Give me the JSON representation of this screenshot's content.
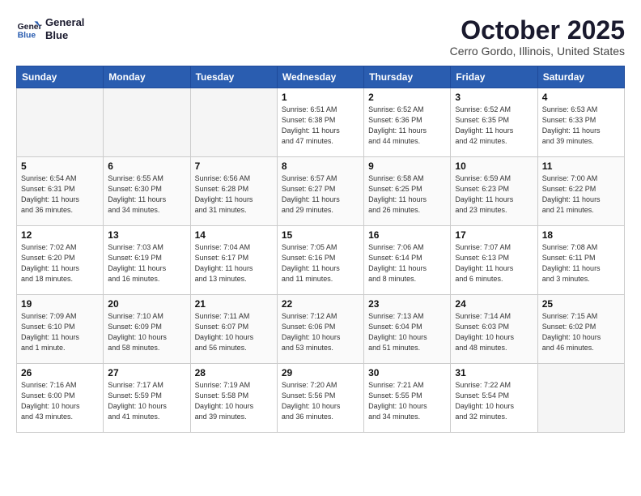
{
  "header": {
    "logo_line1": "General",
    "logo_line2": "Blue",
    "month": "October 2025",
    "location": "Cerro Gordo, Illinois, United States"
  },
  "days_of_week": [
    "Sunday",
    "Monday",
    "Tuesday",
    "Wednesday",
    "Thursday",
    "Friday",
    "Saturday"
  ],
  "weeks": [
    [
      {
        "num": "",
        "info": ""
      },
      {
        "num": "",
        "info": ""
      },
      {
        "num": "",
        "info": ""
      },
      {
        "num": "1",
        "info": "Sunrise: 6:51 AM\nSunset: 6:38 PM\nDaylight: 11 hours\nand 47 minutes."
      },
      {
        "num": "2",
        "info": "Sunrise: 6:52 AM\nSunset: 6:36 PM\nDaylight: 11 hours\nand 44 minutes."
      },
      {
        "num": "3",
        "info": "Sunrise: 6:52 AM\nSunset: 6:35 PM\nDaylight: 11 hours\nand 42 minutes."
      },
      {
        "num": "4",
        "info": "Sunrise: 6:53 AM\nSunset: 6:33 PM\nDaylight: 11 hours\nand 39 minutes."
      }
    ],
    [
      {
        "num": "5",
        "info": "Sunrise: 6:54 AM\nSunset: 6:31 PM\nDaylight: 11 hours\nand 36 minutes."
      },
      {
        "num": "6",
        "info": "Sunrise: 6:55 AM\nSunset: 6:30 PM\nDaylight: 11 hours\nand 34 minutes."
      },
      {
        "num": "7",
        "info": "Sunrise: 6:56 AM\nSunset: 6:28 PM\nDaylight: 11 hours\nand 31 minutes."
      },
      {
        "num": "8",
        "info": "Sunrise: 6:57 AM\nSunset: 6:27 PM\nDaylight: 11 hours\nand 29 minutes."
      },
      {
        "num": "9",
        "info": "Sunrise: 6:58 AM\nSunset: 6:25 PM\nDaylight: 11 hours\nand 26 minutes."
      },
      {
        "num": "10",
        "info": "Sunrise: 6:59 AM\nSunset: 6:23 PM\nDaylight: 11 hours\nand 23 minutes."
      },
      {
        "num": "11",
        "info": "Sunrise: 7:00 AM\nSunset: 6:22 PM\nDaylight: 11 hours\nand 21 minutes."
      }
    ],
    [
      {
        "num": "12",
        "info": "Sunrise: 7:02 AM\nSunset: 6:20 PM\nDaylight: 11 hours\nand 18 minutes."
      },
      {
        "num": "13",
        "info": "Sunrise: 7:03 AM\nSunset: 6:19 PM\nDaylight: 11 hours\nand 16 minutes."
      },
      {
        "num": "14",
        "info": "Sunrise: 7:04 AM\nSunset: 6:17 PM\nDaylight: 11 hours\nand 13 minutes."
      },
      {
        "num": "15",
        "info": "Sunrise: 7:05 AM\nSunset: 6:16 PM\nDaylight: 11 hours\nand 11 minutes."
      },
      {
        "num": "16",
        "info": "Sunrise: 7:06 AM\nSunset: 6:14 PM\nDaylight: 11 hours\nand 8 minutes."
      },
      {
        "num": "17",
        "info": "Sunrise: 7:07 AM\nSunset: 6:13 PM\nDaylight: 11 hours\nand 6 minutes."
      },
      {
        "num": "18",
        "info": "Sunrise: 7:08 AM\nSunset: 6:11 PM\nDaylight: 11 hours\nand 3 minutes."
      }
    ],
    [
      {
        "num": "19",
        "info": "Sunrise: 7:09 AM\nSunset: 6:10 PM\nDaylight: 11 hours\nand 1 minute."
      },
      {
        "num": "20",
        "info": "Sunrise: 7:10 AM\nSunset: 6:09 PM\nDaylight: 10 hours\nand 58 minutes."
      },
      {
        "num": "21",
        "info": "Sunrise: 7:11 AM\nSunset: 6:07 PM\nDaylight: 10 hours\nand 56 minutes."
      },
      {
        "num": "22",
        "info": "Sunrise: 7:12 AM\nSunset: 6:06 PM\nDaylight: 10 hours\nand 53 minutes."
      },
      {
        "num": "23",
        "info": "Sunrise: 7:13 AM\nSunset: 6:04 PM\nDaylight: 10 hours\nand 51 minutes."
      },
      {
        "num": "24",
        "info": "Sunrise: 7:14 AM\nSunset: 6:03 PM\nDaylight: 10 hours\nand 48 minutes."
      },
      {
        "num": "25",
        "info": "Sunrise: 7:15 AM\nSunset: 6:02 PM\nDaylight: 10 hours\nand 46 minutes."
      }
    ],
    [
      {
        "num": "26",
        "info": "Sunrise: 7:16 AM\nSunset: 6:00 PM\nDaylight: 10 hours\nand 43 minutes."
      },
      {
        "num": "27",
        "info": "Sunrise: 7:17 AM\nSunset: 5:59 PM\nDaylight: 10 hours\nand 41 minutes."
      },
      {
        "num": "28",
        "info": "Sunrise: 7:19 AM\nSunset: 5:58 PM\nDaylight: 10 hours\nand 39 minutes."
      },
      {
        "num": "29",
        "info": "Sunrise: 7:20 AM\nSunset: 5:56 PM\nDaylight: 10 hours\nand 36 minutes."
      },
      {
        "num": "30",
        "info": "Sunrise: 7:21 AM\nSunset: 5:55 PM\nDaylight: 10 hours\nand 34 minutes."
      },
      {
        "num": "31",
        "info": "Sunrise: 7:22 AM\nSunset: 5:54 PM\nDaylight: 10 hours\nand 32 minutes."
      },
      {
        "num": "",
        "info": ""
      }
    ]
  ]
}
